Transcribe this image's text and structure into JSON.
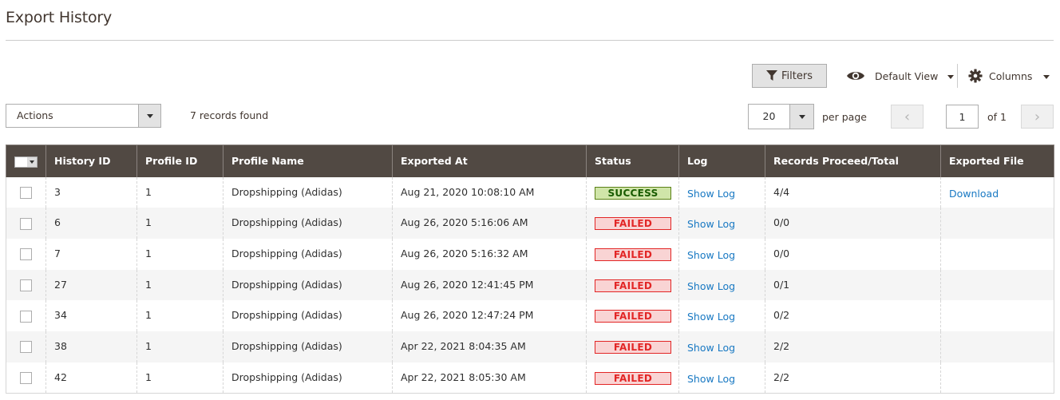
{
  "page": {
    "title": "Export History"
  },
  "toolbar": {
    "filters_label": "Filters",
    "view_label": "Default View",
    "columns_label": "Columns",
    "actions_label": "Actions",
    "records_found": "7 records found",
    "per_page_value": "20",
    "per_page_label": "per page",
    "page_current": "1",
    "page_total": "of 1",
    "prev_glyph": "‹",
    "next_glyph": "›"
  },
  "grid": {
    "columns": [
      "History ID",
      "Profile ID",
      "Profile Name",
      "Exported At",
      "Status",
      "Log",
      "Records Proceed/Total",
      "Exported File"
    ],
    "rows": [
      {
        "history_id": "3",
        "profile_id": "1",
        "profile_name": "Dropshipping (Adidas)",
        "exported_at": "Aug 21, 2020 10:08:10 AM",
        "status": "SUCCESS",
        "status_type": "success",
        "log": "Show Log",
        "records": "4/4",
        "file": "Download"
      },
      {
        "history_id": "6",
        "profile_id": "1",
        "profile_name": "Dropshipping (Adidas)",
        "exported_at": "Aug 26, 2020 5:16:06 AM",
        "status": "FAILED",
        "status_type": "failed",
        "log": "Show Log",
        "records": "0/0",
        "file": ""
      },
      {
        "history_id": "7",
        "profile_id": "1",
        "profile_name": "Dropshipping (Adidas)",
        "exported_at": "Aug 26, 2020 5:16:32 AM",
        "status": "FAILED",
        "status_type": "failed",
        "log": "Show Log",
        "records": "0/0",
        "file": ""
      },
      {
        "history_id": "27",
        "profile_id": "1",
        "profile_name": "Dropshipping (Adidas)",
        "exported_at": "Aug 26, 2020 12:41:45 PM",
        "status": "FAILED",
        "status_type": "failed",
        "log": "Show Log",
        "records": "0/1",
        "file": ""
      },
      {
        "history_id": "34",
        "profile_id": "1",
        "profile_name": "Dropshipping (Adidas)",
        "exported_at": "Aug 26, 2020 12:47:24 PM",
        "status": "FAILED",
        "status_type": "failed",
        "log": "Show Log",
        "records": "0/2",
        "file": ""
      },
      {
        "history_id": "38",
        "profile_id": "1",
        "profile_name": "Dropshipping (Adidas)",
        "exported_at": "Apr 22, 2021 8:04:35 AM",
        "status": "FAILED",
        "status_type": "failed",
        "log": "Show Log",
        "records": "2/2",
        "file": ""
      },
      {
        "history_id": "42",
        "profile_id": "1",
        "profile_name": "Dropshipping (Adidas)",
        "exported_at": "Apr 22, 2021 8:05:30 AM",
        "status": "FAILED",
        "status_type": "failed",
        "log": "Show Log",
        "records": "2/2",
        "file": ""
      }
    ]
  },
  "colors": {
    "header_bg": "#514943",
    "link": "#1979c3",
    "success_bg": "#d0e5a9",
    "success_text": "#185b00",
    "failed_bg": "#f9d4d4",
    "failed_text": "#e22626"
  }
}
